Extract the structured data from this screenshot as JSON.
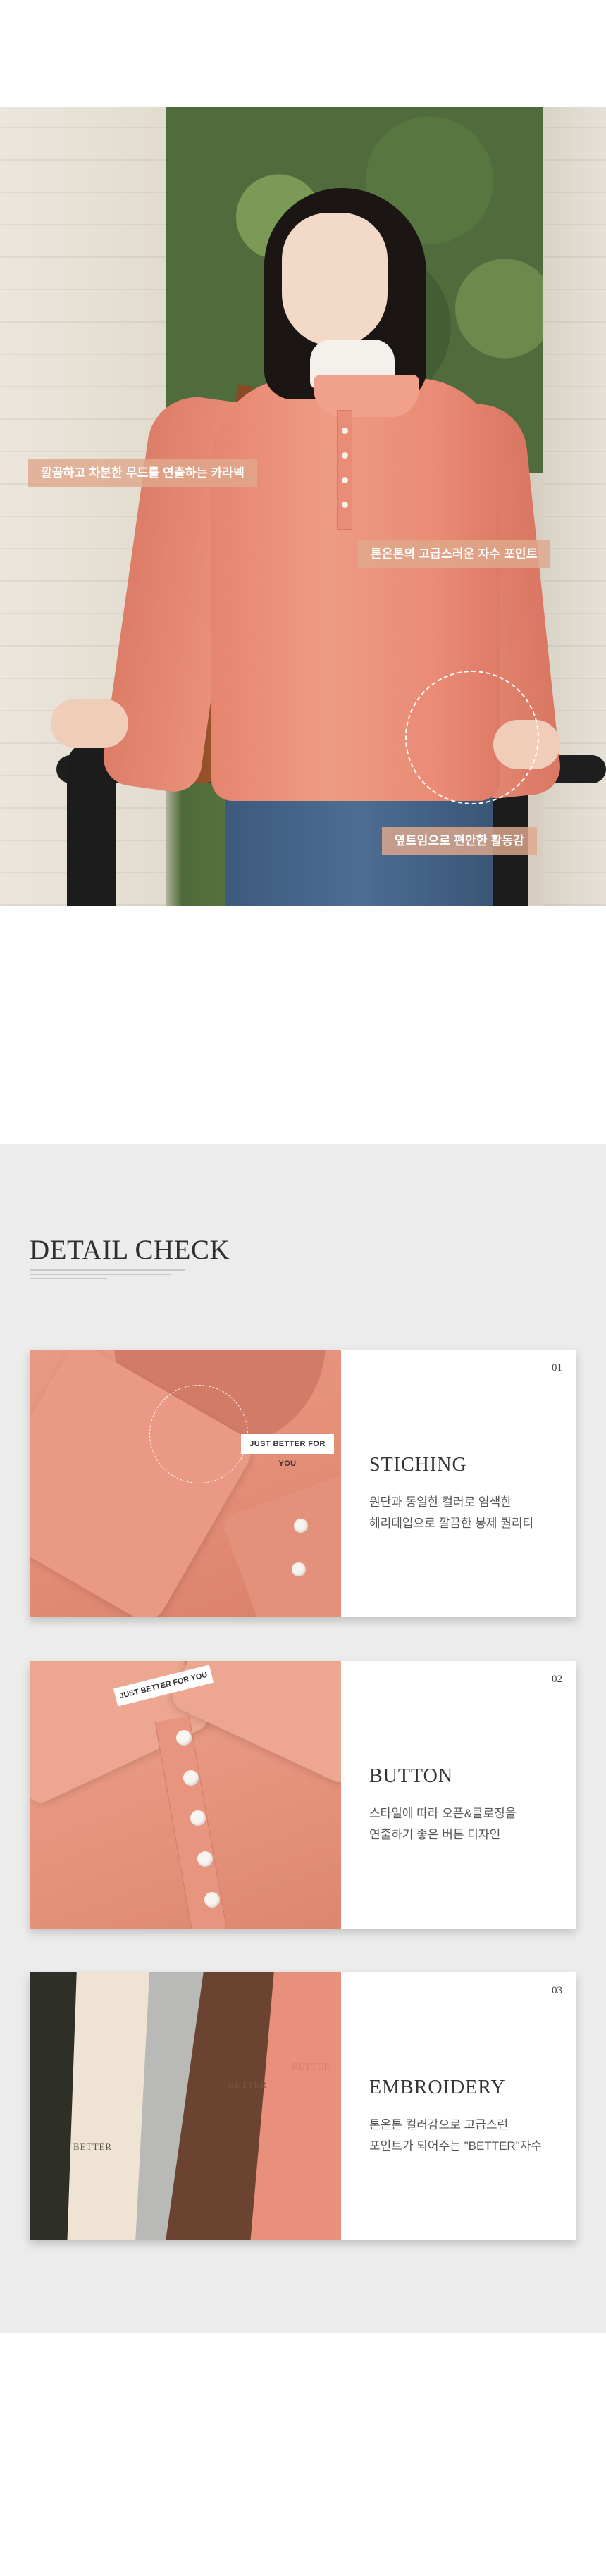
{
  "hero": {
    "callouts": [
      "깔끔하고 차분한 무드를 연출하는 카라넥",
      "톤온톤의 고급스러운 자수 포인트",
      "옆트임으로 편안한 활동감"
    ]
  },
  "detail": {
    "title": "DETAIL CHECK",
    "cards": [
      {
        "number": "01",
        "heading": "STICHING",
        "desc": [
          "원단과 동일한 컬러로 염색한",
          "헤리테입으로 깔끔한 봉제 퀄리티"
        ],
        "label": "JUST BETTER FOR YOU"
      },
      {
        "number": "02",
        "heading": "BUTTON",
        "desc": [
          "스타일에 따라 오픈&클로징을",
          "연출하기 좋은 버튼 디자인"
        ],
        "label": "JUST BETTER FOR YOU"
      },
      {
        "number": "03",
        "heading": "EMBROIDERY",
        "desc": [
          "톤온톤 컬러감으로 고급스런",
          "포인트가 되어주는 \"BETTER\"자수"
        ],
        "swatch_colors": [
          "#2e3028",
          "#efe4d3",
          "#b9b9b7",
          "#6b4331",
          "#e8907c"
        ],
        "embroidery_text": "BETTER"
      }
    ]
  },
  "colors": {
    "accent_coral": "#e8907c",
    "callout_bg": "#dfa88c",
    "section_bg": "#ececec"
  }
}
